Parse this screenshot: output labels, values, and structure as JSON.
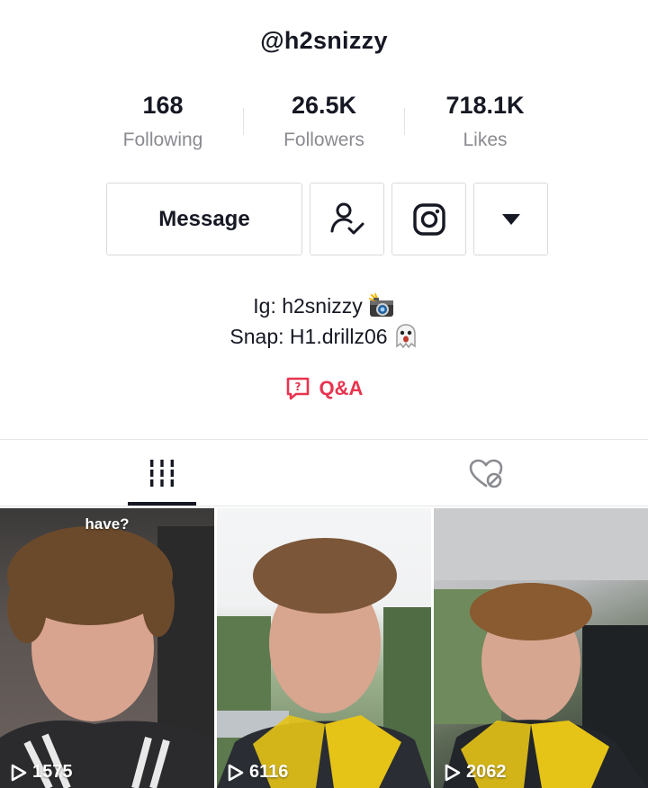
{
  "profile": {
    "username": "@h2snizzy",
    "stats": [
      {
        "value": "168",
        "label": "Following"
      },
      {
        "value": "26.5K",
        "label": "Followers"
      },
      {
        "value": "718.1K",
        "label": "Likes"
      }
    ],
    "message_label": "Message",
    "bio": {
      "line1": "Ig: h2snizzy",
      "line2": "Snap: H1.drillz06"
    },
    "qa_label": "Q&A"
  },
  "tabs": {
    "videos_icon": "grid-icon",
    "liked_icon": "hidden-heart-icon"
  },
  "videos": [
    {
      "caption": "have?",
      "views": "1575"
    },
    {
      "caption": "",
      "views": "6116"
    },
    {
      "caption": "",
      "views": "2062"
    }
  ],
  "colors": {
    "accent": "#e8344f",
    "text": "#161823",
    "secondary": "#8a8b91"
  }
}
